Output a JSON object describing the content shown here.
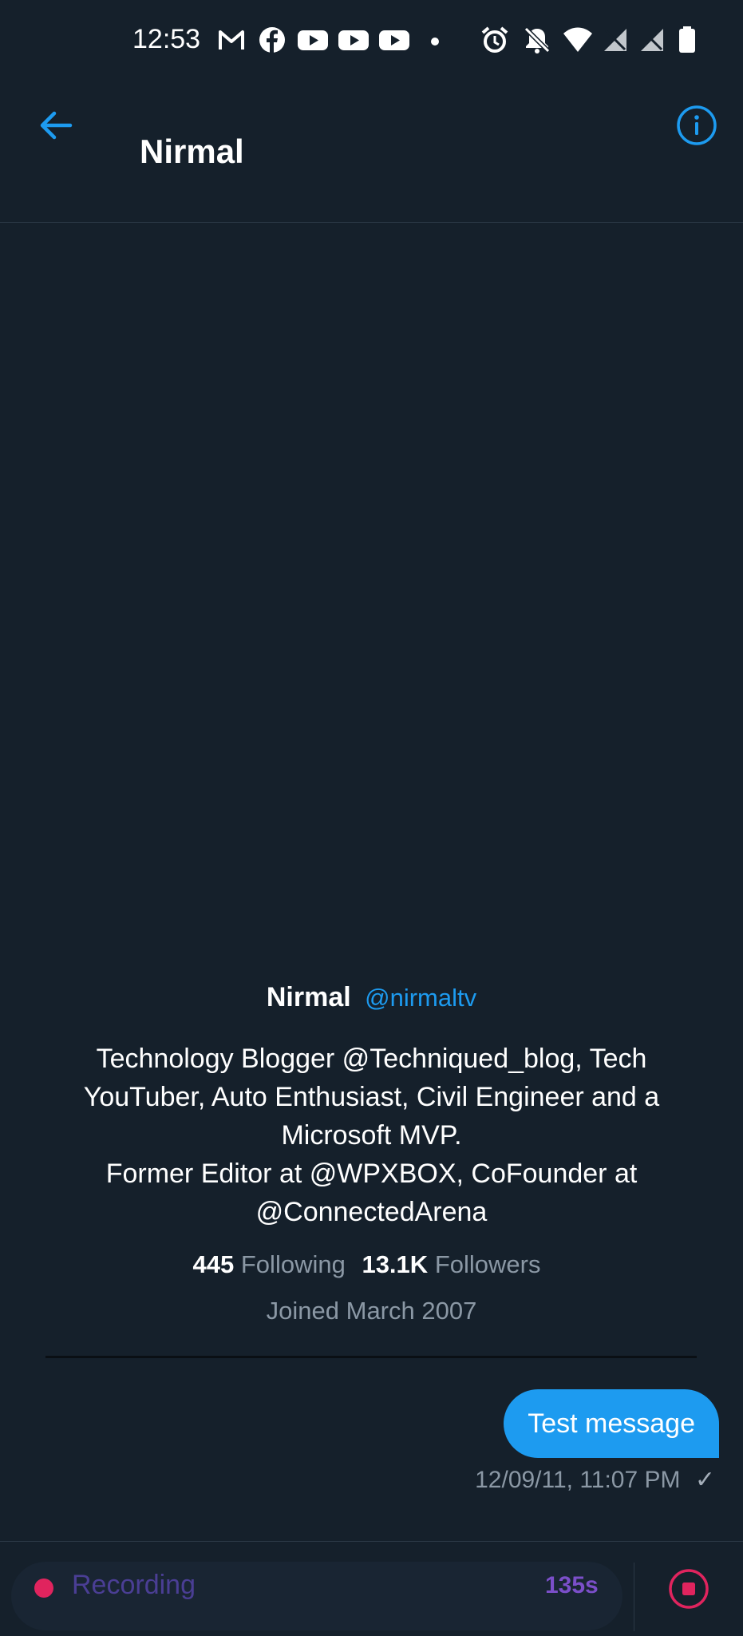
{
  "status_bar": {
    "time": "12:53",
    "left_icons": [
      "gmail-icon",
      "facebook-icon",
      "youtube-icon",
      "youtube-icon",
      "youtube-icon",
      "notification-dot-icon"
    ],
    "right_icons": [
      "alarm-icon",
      "notifications-off-icon",
      "wifi-icon",
      "no-signal-icon",
      "no-signal-icon",
      "battery-icon"
    ]
  },
  "header": {
    "title": "Nirmal",
    "back_icon": "arrow-left-icon",
    "info_icon": "info-icon"
  },
  "profile": {
    "name": "Nirmal",
    "handle": "@nirmaltv",
    "bio_lines": [
      "Technology Blogger @Techniqued_blog, Tech YouTuber, Auto Enthusiast, Civil Engineer and a Microsoft MVP.",
      "Former Editor at @WPXBOX, CoFounder at @ConnectedArena"
    ],
    "following_count": "445",
    "following_label": "Following",
    "followers_count": "13.1K",
    "followers_label": "Followers",
    "joined": "Joined March 2007"
  },
  "messages": [
    {
      "text": "Test message",
      "timestamp": "12/09/11, 11:07 PM",
      "status_icon": "check-icon"
    }
  ],
  "composer": {
    "recording_label": "Recording",
    "seconds": "135s",
    "stop_icon": "stop-icon"
  },
  "colors": {
    "background": "#15202b",
    "accent": "#1d9bf0",
    "recording_dot": "#e0245e",
    "recording_seconds": "#7b4fc9"
  }
}
